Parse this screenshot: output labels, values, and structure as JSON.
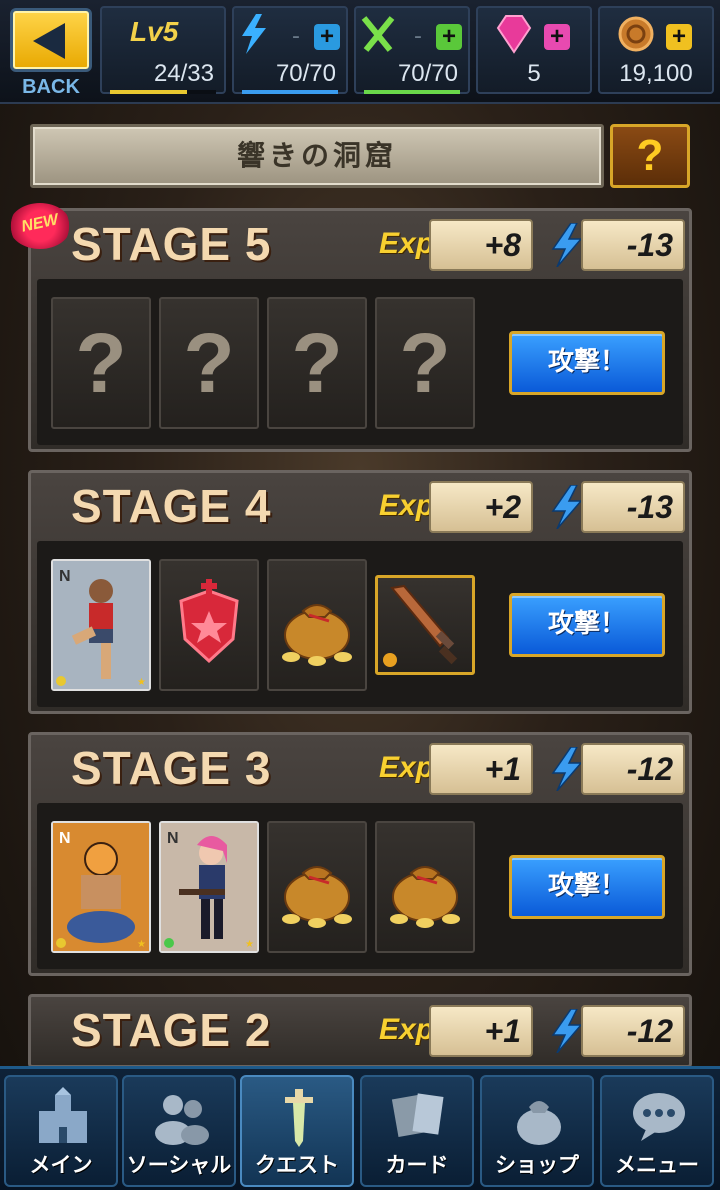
{
  "header": {
    "back_label": "BACK",
    "level": {
      "label": "Lv",
      "value": "5",
      "exp_text": "24/33",
      "exp_fraction": 0.727
    },
    "stamina": {
      "value": "70/70",
      "fraction": 1.0,
      "color": "#3a9cf0",
      "icon": "lightning-bolt-icon"
    },
    "battle_points": {
      "value": "70/70",
      "fraction": 1.0,
      "color": "#6ad84a",
      "icon": "crossed-swords-icon"
    },
    "gems": {
      "value": "5",
      "icon": "gem-icon"
    },
    "coins": {
      "value": "19,100",
      "icon": "coin-icon"
    }
  },
  "area": {
    "title": "響きの洞窟",
    "help_label": "?"
  },
  "stages": [
    {
      "title": "STAGE 5",
      "is_new": true,
      "new_label": "NEW",
      "exp_label": "Exp",
      "exp": "+8",
      "stamina": "-13",
      "rewards": [
        "unknown",
        "unknown",
        "unknown",
        "unknown"
      ],
      "attack_label": "攻撃！"
    },
    {
      "title": "STAGE 4",
      "is_new": false,
      "exp_label": "Exp",
      "exp": "+2",
      "stamina": "-13",
      "rewards": [
        "fighter-card",
        "crown-emblem",
        "coin-bag",
        "sword-item"
      ],
      "attack_label": "攻撃！"
    },
    {
      "title": "STAGE 3",
      "is_new": false,
      "exp_label": "Exp",
      "exp": "+1",
      "stamina": "-12",
      "rewards": [
        "tiger-card",
        "gunner-card",
        "coin-bag",
        "coin-bag"
      ],
      "attack_label": "攻撃！"
    },
    {
      "title": "STAGE 2",
      "is_new": false,
      "exp_label": "Exp",
      "exp": "+1",
      "stamina": "-12"
    }
  ],
  "unknown_reward_label": "?",
  "card_rarity_label": "N",
  "nav": [
    {
      "label": "メイン",
      "icon": "castle-icon"
    },
    {
      "label": "ソーシャル",
      "icon": "friends-icon"
    },
    {
      "label": "クエスト",
      "icon": "sword-icon",
      "active": true
    },
    {
      "label": "カード",
      "icon": "cards-icon"
    },
    {
      "label": "ショップ",
      "icon": "money-bag-icon"
    },
    {
      "label": "メニュー",
      "icon": "chat-bubble-icon"
    }
  ]
}
